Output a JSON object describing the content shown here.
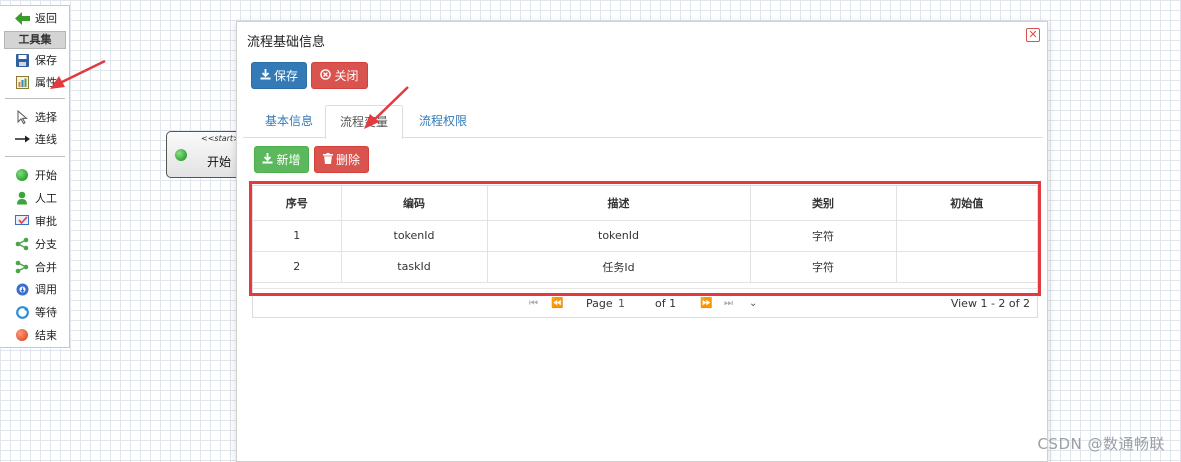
{
  "toolbox": {
    "top_items": [
      {
        "label": "返回",
        "icon": "back-arrow-icon"
      }
    ],
    "header": "工具集",
    "items": [
      {
        "label": "保存",
        "icon": "floppy-disk-icon"
      },
      {
        "label": "属性",
        "icon": "properties-icon"
      }
    ],
    "tools": [
      {
        "label": "选择",
        "icon": "cursor-icon"
      },
      {
        "label": "连线",
        "icon": "connector-arrow-icon"
      }
    ],
    "nodes": [
      {
        "label": "开始",
        "icon": "start-node-icon"
      },
      {
        "label": "人工",
        "icon": "user-task-icon"
      },
      {
        "label": "审批",
        "icon": "approval-icon"
      },
      {
        "label": "分支",
        "icon": "fork-icon"
      },
      {
        "label": "合并",
        "icon": "join-icon"
      },
      {
        "label": "调用",
        "icon": "subprocess-icon"
      },
      {
        "label": "等待",
        "icon": "wait-icon"
      },
      {
        "label": "结束",
        "icon": "end-node-icon"
      }
    ]
  },
  "canvas": {
    "start_node": {
      "stereotype": "<<start>>",
      "label": "开始"
    }
  },
  "dialog": {
    "title": "流程基础信息",
    "close_glyph": "✕",
    "save_label": "保存",
    "close_label": "关闭",
    "tabs": [
      "基本信息",
      "流程变量",
      "流程权限"
    ],
    "active_tab": 1,
    "add_label": "新增",
    "delete_label": "删除",
    "table": {
      "columns": [
        "序号",
        "编码",
        "描述",
        "类别",
        "初始值"
      ],
      "rows": [
        [
          "1",
          "tokenId",
          "tokenId",
          "字符",
          ""
        ],
        [
          "2",
          "taskId",
          "任务Id",
          "字符",
          ""
        ]
      ]
    },
    "pager": {
      "page_label": "Page",
      "page_value": "1",
      "of_text": "of 1",
      "view_text": "View 1 - 2 of 2"
    }
  },
  "watermark": "CSDN @数通畅联",
  "colors": {
    "primary": "#337ab7",
    "danger": "#d9534f",
    "success": "#5cb85c",
    "highlight": "#e23a3f"
  }
}
